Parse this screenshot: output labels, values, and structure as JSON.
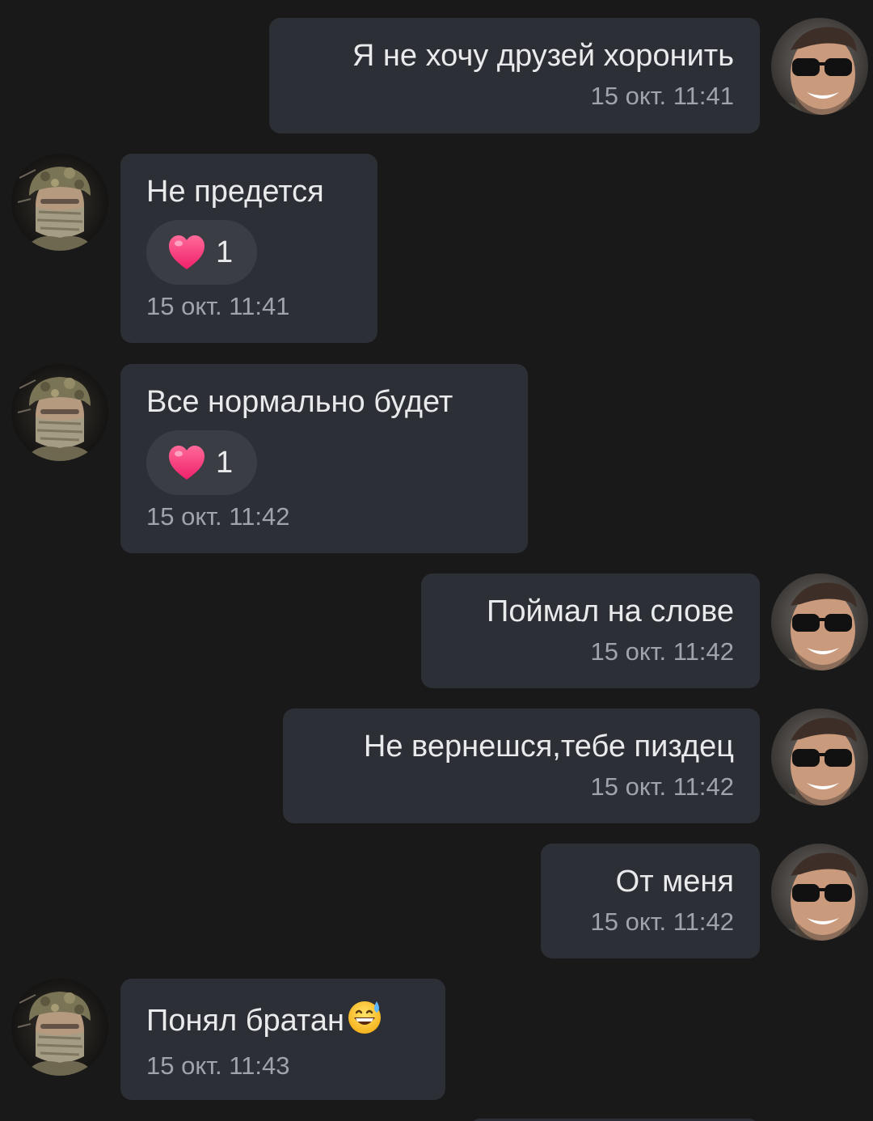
{
  "messages": [
    {
      "text": "Я не хочу друзей хоронить",
      "time": "15 окт. 11:41"
    },
    {
      "text": "Не предется",
      "time": "15 окт. 11:41",
      "reaction": {
        "icon": "heart-icon",
        "count": "1"
      }
    },
    {
      "text": "Все нормально будет",
      "time": "15 окт. 11:42",
      "reaction": {
        "icon": "heart-icon",
        "count": "1"
      }
    },
    {
      "text": "Поймал на слове",
      "time": "15 окт. 11:42"
    },
    {
      "text": "Не вернешся,тебе пиздец",
      "time": "15 окт. 11:42"
    },
    {
      "text": "От меня",
      "time": "15 окт. 11:42"
    },
    {
      "text": "Понял братан",
      "emoji": "grinning-sweat-emoji",
      "time": "15 окт. 11:43"
    }
  ],
  "colors": {
    "background": "#19191a",
    "bubble": "#2d2f36",
    "reaction_pill": "#3b3d45",
    "text": "#e9eaec",
    "time": "#a0a3ab",
    "heart": "#ff3d7f"
  }
}
